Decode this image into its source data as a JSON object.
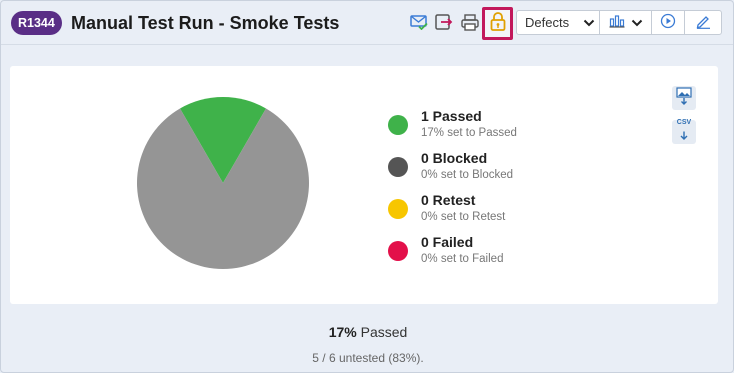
{
  "run": {
    "id": "R1344",
    "title": "Manual Test Run - Smoke Tests"
  },
  "toolbar": {
    "icons": [
      "email-check-icon",
      "export-icon",
      "print-icon",
      "lock-icon"
    ],
    "defects_label": "Defects",
    "chart_icon": "bar-chart-icon",
    "play_icon": "play-icon",
    "edit_icon": "pencil-icon"
  },
  "chart_data": {
    "type": "pie",
    "slices": [
      {
        "label": "Passed",
        "value": 1,
        "color": "#3fb24a"
      },
      {
        "label": "Blocked",
        "value": 0,
        "color": "#555555"
      },
      {
        "label": "Retest",
        "value": 0,
        "color": "#f7c600"
      },
      {
        "label": "Failed",
        "value": 0,
        "color": "#e3104a"
      },
      {
        "label": "Untested",
        "value": 5,
        "color": "#959595"
      }
    ]
  },
  "legend": [
    {
      "title": "1 Passed",
      "sub": "17% set to Passed",
      "color": "#3fb24a"
    },
    {
      "title": "0 Blocked",
      "sub": "0% set to Blocked",
      "color": "#555555"
    },
    {
      "title": "0 Retest",
      "sub": "0% set to Retest",
      "color": "#f7c600"
    },
    {
      "title": "0 Failed",
      "sub": "0% set to Failed",
      "color": "#e3104a"
    }
  ],
  "exports": {
    "image_icon": "image-download-icon",
    "csv_label": "CSV"
  },
  "summary": {
    "percent": "17%",
    "label": "Passed",
    "untested": "5 / 6 untested (83%)."
  }
}
